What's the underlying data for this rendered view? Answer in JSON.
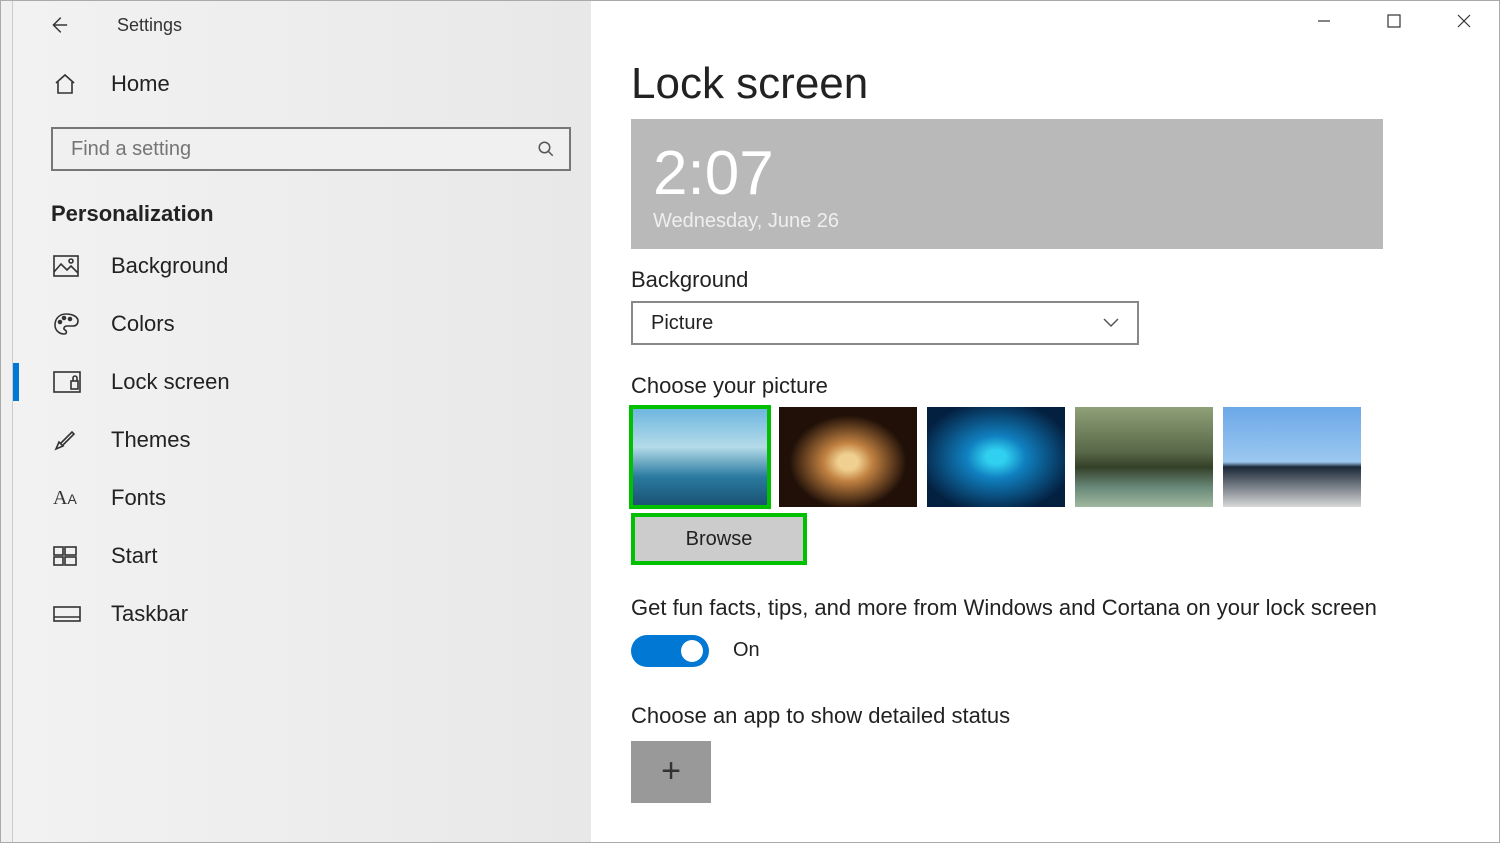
{
  "app_title": "Settings",
  "home_label": "Home",
  "search_placeholder": "Find a setting",
  "section": "Personalization",
  "nav": [
    {
      "label": "Background"
    },
    {
      "label": "Colors"
    },
    {
      "label": "Lock screen"
    },
    {
      "label": "Themes"
    },
    {
      "label": "Fonts"
    },
    {
      "label": "Start"
    },
    {
      "label": "Taskbar"
    }
  ],
  "page_title": "Lock screen",
  "preview": {
    "time": "2:07",
    "date": "Wednesday, June 26"
  },
  "background_label": "Background",
  "background_value": "Picture",
  "choose_picture_label": "Choose your picture",
  "browse_label": "Browse",
  "tips_label": "Get fun facts, tips, and more from Windows and Cortana on your lock screen",
  "toggle_label": "On",
  "detailed_status_label": "Choose an app to show detailed status"
}
